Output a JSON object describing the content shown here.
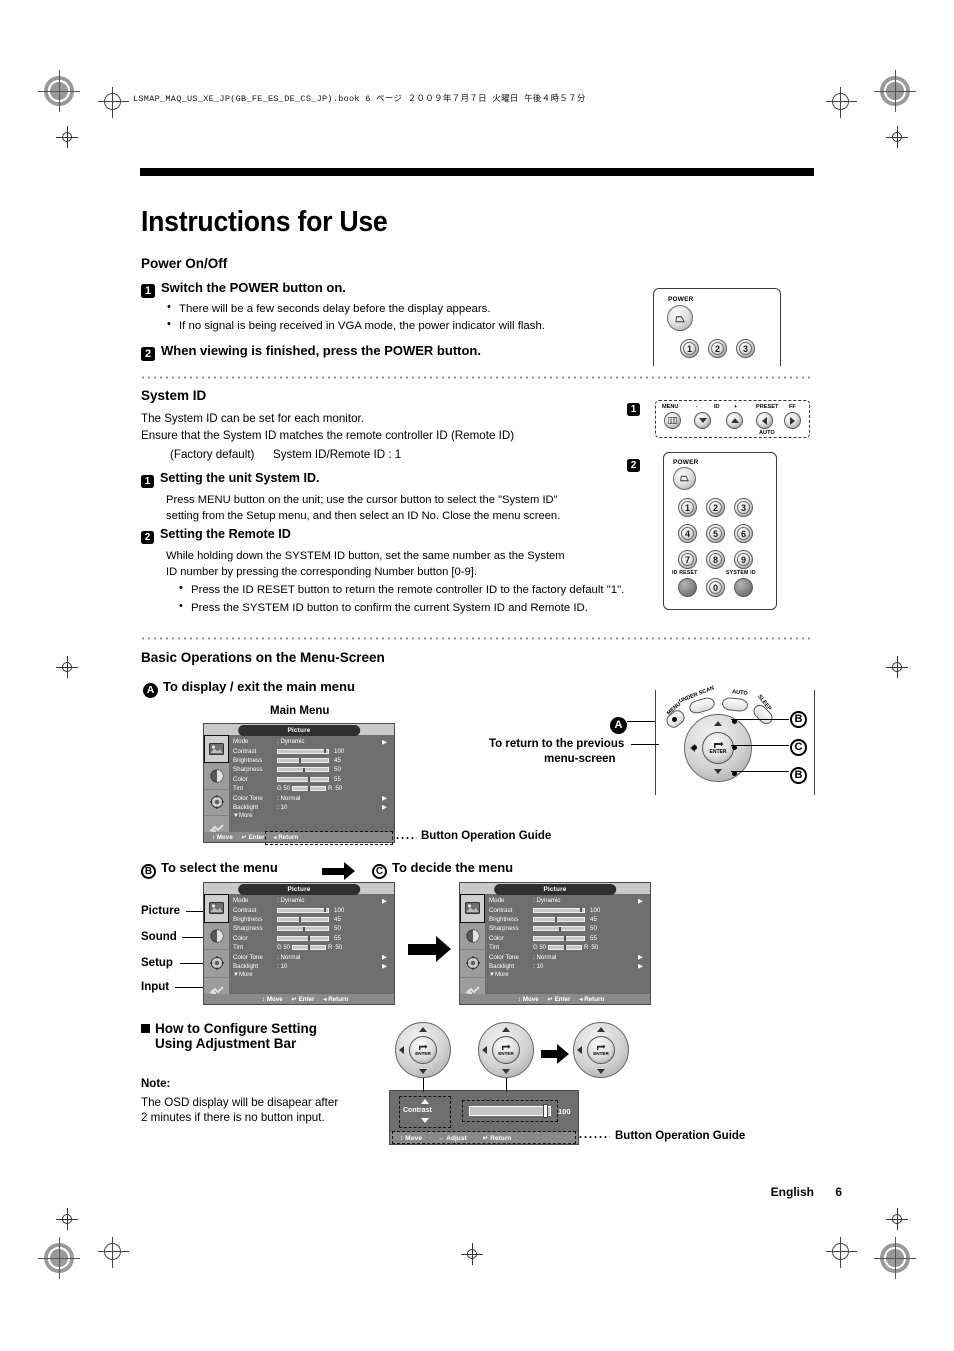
{
  "page": {
    "file_header": "LSMAP_MAQ_US_XE_JP(GB_FE_ES_DE_CS_JP).book   6 ページ   ２００９年７月７日   火曜日   午後４時５７分",
    "title": "Instructions for Use",
    "footer_language": "English",
    "footer_page": "6"
  },
  "power_section": {
    "heading": "Power On/Off",
    "step1": {
      "num": "1",
      "title": "Switch the POWER button on.",
      "bullets": [
        "There will be a few seconds delay before the display appears.",
        "If no signal is being received in VGA mode, the power indicator will flash."
      ]
    },
    "step2": {
      "num": "2",
      "title": "When viewing is finished, press the POWER button."
    }
  },
  "system_id_section": {
    "heading": "System ID",
    "line1": "The System ID can be set for each monitor.",
    "line2": "Ensure that the System ID matches the remote controller ID (Remote ID)",
    "factory_default_label": "(Factory default)",
    "factory_default_value": "System ID/Remote ID : 1",
    "callout_1": "1",
    "callout_2": "2",
    "step1": {
      "num": "1",
      "title": "Setting the unit System ID.",
      "body_line1": "Press MENU button on the unit; use the cursor button to select the \"System ID\"",
      "body_line2": "setting from the Setup menu, and then select an ID No. Close the menu screen."
    },
    "step2": {
      "num": "2",
      "title": "Setting the Remote ID",
      "body_line1": "While holding down the SYSTEM ID button, set the same number as the System",
      "body_line2": "ID number by pressing the corresponding Number button [0-9].",
      "bullets": [
        "Press the ID RESET button to return the remote controller ID to the factory default \"1\".",
        "Press the SYSTEM ID button to confirm the current System ID and Remote ID."
      ]
    }
  },
  "menu_section": {
    "heading": "Basic Operations on the Menu-Screen",
    "step_a": {
      "marker": "A",
      "title": "To display / exit the main menu"
    },
    "main_menu_caption": "Main Menu",
    "button_operation_guide": "Button Operation Guide",
    "return_note_line1": "To return to the previous",
    "return_note_line2": "menu-screen",
    "step_b": {
      "marker": "B",
      "title": "To select the menu"
    },
    "step_c": {
      "marker": "C",
      "title": "To decide the menu"
    },
    "side_labels": [
      "Picture",
      "Sound",
      "Setup",
      "Input"
    ],
    "callout_a": "A",
    "callout_b1": "B",
    "callout_b2": "B",
    "callout_c": "C"
  },
  "osd": {
    "title": "Picture",
    "rows": [
      {
        "name": "Mode",
        "type": "text",
        "value": "Dynamic",
        "arrow": true
      },
      {
        "name": "Contrast",
        "type": "bar",
        "value": "100",
        "fill": 96
      },
      {
        "name": "Brightness",
        "type": "bar",
        "value": "45",
        "fill": 45
      },
      {
        "name": "Sharpness",
        "type": "bar",
        "value": "50",
        "fill": 52
      },
      {
        "name": "Color",
        "type": "bar",
        "value": "55",
        "fill": 62
      },
      {
        "name": "Tint",
        "type": "tint",
        "value": "50",
        "fill": 50,
        "left_label": "G 50",
        "right_label": "R"
      },
      {
        "name": "Color Tone",
        "type": "text",
        "value": "Normal",
        "arrow": true
      },
      {
        "name": "Backlight",
        "type": "text",
        "value": "10",
        "arrow": true
      }
    ],
    "more": "More",
    "guide": [
      {
        "icon": "updown",
        "label": "Move"
      },
      {
        "icon": "enter",
        "label": "Enter"
      },
      {
        "icon": "left",
        "label": "Return"
      }
    ]
  },
  "adjustment_section": {
    "heading_line1": "How to Configure Setting",
    "heading_line2": "Using Adjustment Bar",
    "note_label": "Note:",
    "note_line1": "The OSD display will be disapear after",
    "note_line2": "2 minutes if there is no button input.",
    "button_operation_guide": "Button Operation Guide",
    "bar_item_label": "Contrast",
    "bar_value": "100",
    "guide": [
      {
        "icon": "updown",
        "label": "Move"
      },
      {
        "icon": "leftright",
        "label": "Adjust"
      },
      {
        "icon": "enter",
        "label": "Return"
      }
    ]
  },
  "remote_top": {
    "power_label": "POWER",
    "buttons": [
      "1",
      "2",
      "3"
    ]
  },
  "unit_panel": {
    "buttons": [
      {
        "label": "MENU",
        "glyph": "menu"
      },
      {
        "label": "ID",
        "minus": "-",
        "plus": "+",
        "glyph": "down"
      },
      {
        "label": "",
        "glyph": "up"
      },
      {
        "label": "PRESET",
        "sub": "AUTO",
        "glyph": "left"
      },
      {
        "label": "FF",
        "glyph": "right"
      }
    ]
  },
  "remote_full": {
    "power_label": "POWER",
    "numbers": [
      "1",
      "2",
      "3",
      "4",
      "5",
      "6",
      "7",
      "8",
      "9"
    ],
    "zero": "0",
    "id_reset_label": "ID RESET",
    "system_id_label": "SYSTEM ID"
  },
  "navpad": {
    "menu_label": "MENU",
    "under_scan_label": "UNDER SCAN",
    "auto_label": "AUTO",
    "sleep_label": "SLEEP",
    "enter_label": "ENTER"
  },
  "colors": {
    "page_bg": "#ffffff",
    "ink": "#000000",
    "osd_bg": "#6e6e6e",
    "osd_icon_bg": "#9c9c9c",
    "osd_title_bar": "#c9c9c9",
    "osd_guide_bg": "#8a8a8a"
  }
}
